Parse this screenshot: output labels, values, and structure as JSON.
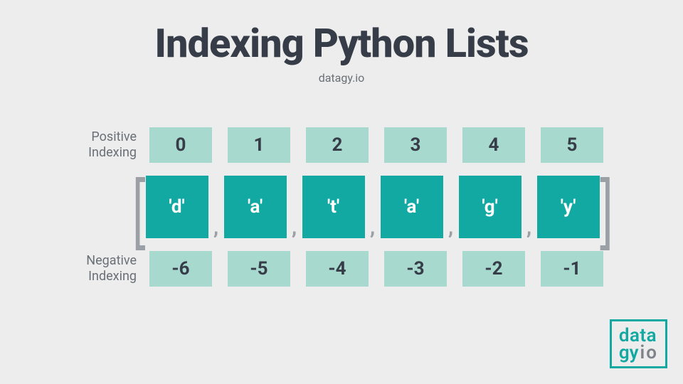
{
  "title": "Indexing Python Lists",
  "subtitle": "datagy.io",
  "positive_label_l1": "Positive",
  "positive_label_l2": "Indexing",
  "negative_label_l1": "Negative",
  "negative_label_l2": "Indexing",
  "positive_indices": [
    "0",
    "1",
    "2",
    "3",
    "4",
    "5"
  ],
  "list_values": [
    "'d'",
    "'a'",
    "'t'",
    "'a'",
    "'g'",
    "'y'"
  ],
  "negative_indices": [
    "-6",
    "-5",
    "-4",
    "-3",
    "-2",
    "-1"
  ],
  "bracket_left": "[",
  "bracket_right": "]",
  "comma": ",",
  "logo": {
    "line1": "data",
    "gy": "gy",
    "io": "io"
  },
  "colors": {
    "accent": "#13a9a3",
    "light": "#a8d9ce",
    "text": "#363d48",
    "muted": "#6b7077"
  }
}
